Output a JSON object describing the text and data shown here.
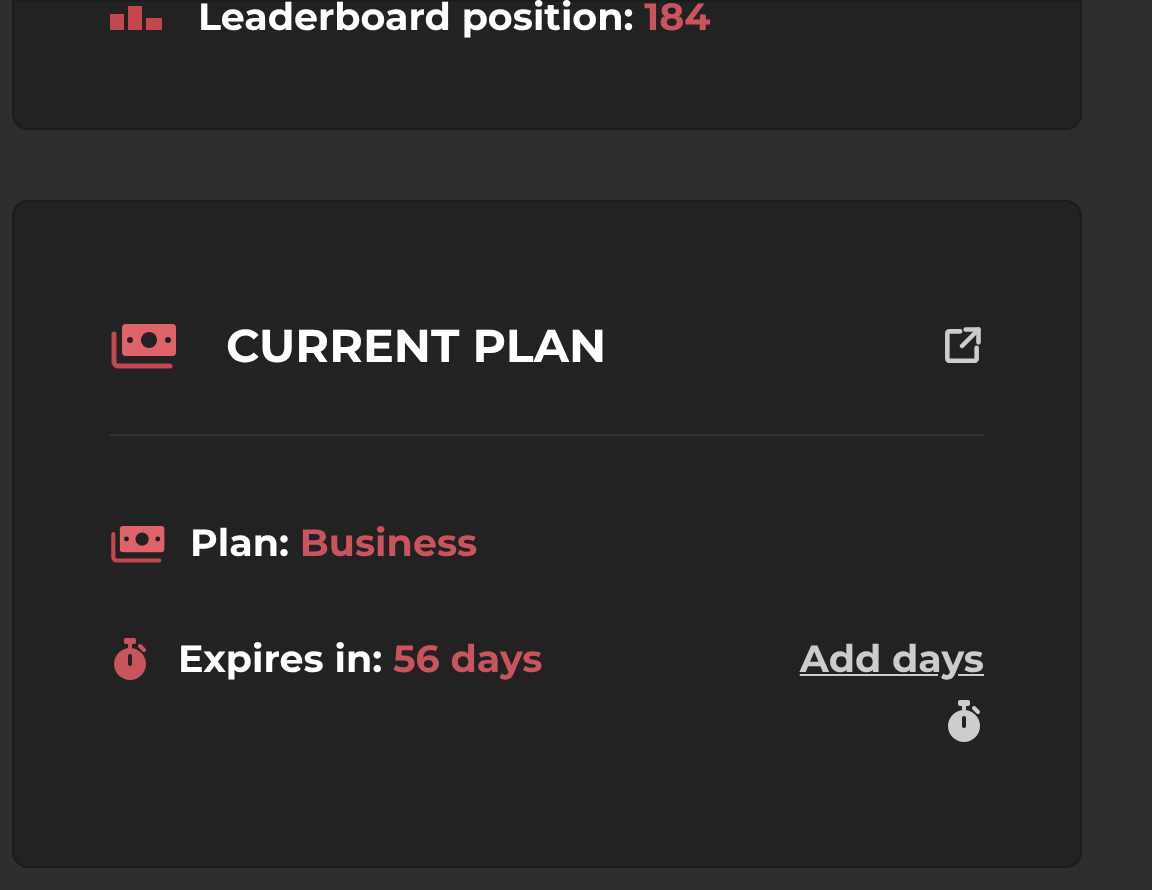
{
  "leaderboard": {
    "label": "Leaderboard position:",
    "value": "184"
  },
  "current_plan": {
    "title": "CURRENT PLAN",
    "plan": {
      "label": "Plan:",
      "value": "Business"
    },
    "expires": {
      "label": "Expires in:",
      "value": "56 days"
    },
    "add_days_link": "Add days"
  }
}
